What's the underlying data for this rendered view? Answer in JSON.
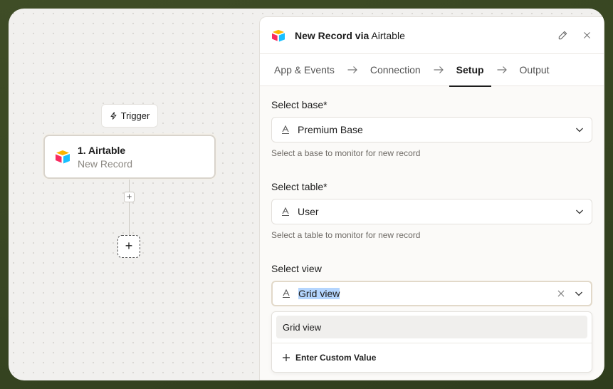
{
  "canvas": {
    "trigger_label": "Trigger",
    "node": {
      "title": "1. Airtable",
      "subtitle": "New Record"
    },
    "small_plus": "+",
    "add_step": "+"
  },
  "panel": {
    "title_bold": "New Record via",
    "title_rest": " Airtable",
    "tabs": [
      {
        "label": "App & Events"
      },
      {
        "label": "Connection"
      },
      {
        "label": "Setup"
      },
      {
        "label": "Output"
      }
    ],
    "active_tab": "Setup",
    "fields": {
      "base": {
        "label": "Select base*",
        "value": "Premium Base",
        "hint": "Select a base to monitor for new record"
      },
      "table": {
        "label": "Select table*",
        "value": "User",
        "hint": "Select a table to monitor for new record"
      },
      "view": {
        "label": "Select view",
        "value": "Grid view"
      }
    },
    "dropdown": {
      "options": [
        "Grid view"
      ],
      "custom_label": "Enter Custom Value"
    }
  },
  "colors": {
    "frame": "#3c4a26",
    "canvas": "#f1f0ee",
    "selection_highlight": "#b4d5fe",
    "airtable_yellow": "#fcb400",
    "airtable_red": "#f82b60",
    "airtable_blue": "#18bfff"
  }
}
